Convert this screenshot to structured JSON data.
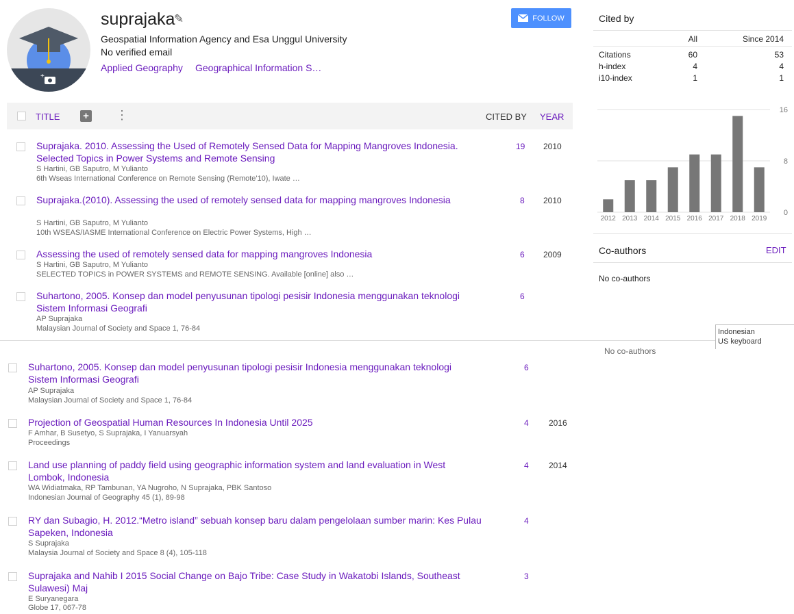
{
  "profile": {
    "name": "suprajaka",
    "affiliation": "Geospatial Information Agency and Esa Unggul University",
    "email": "No verified email",
    "interests": [
      "Applied Geography",
      "Geographical Information S…"
    ],
    "follow_label": "FOLLOW"
  },
  "table_header": {
    "title": "TITLE",
    "cited_by": "CITED BY",
    "year": "YEAR"
  },
  "articles_top": [
    {
      "title": "Suprajaka. 2010. Assessing the Used of Remotely Sensed Data for Mapping Mangroves Indonesia. Selected Topics in Power Systems and Remote Sensing",
      "authors": "S Hartini, GB Saputro, M Yulianto",
      "pub": "6th Wseas International Conference on Remote Sensing (Remote'10), Iwate …",
      "cited": "19",
      "year": "2010"
    },
    {
      "title": "Suprajaka.(2010). Assessing the used of remotely sensed data for mapping mangroves Indonesia",
      "authors": "S Hartini, GB Saputro, M Yulianto",
      "pub": "10th WSEAS/IASME International Conference on Electric Power Systems, High …",
      "cited": "8",
      "year": "2010"
    },
    {
      "title": "Assessing the used of remotely sensed data for mapping mangroves Indonesia",
      "authors": "S Hartini, GB Saputro, M Yulianto",
      "pub": "SELECTED TOPICS in POWER SYSTEMS and REMOTE SENSING. Available [online] also …",
      "cited": "6",
      "year": "2009"
    },
    {
      "title": "Suhartono, 2005. Konsep dan model penyusunan tipologi pesisir Indonesia menggunakan teknologi Sistem Informasi Geografi",
      "authors": "AP Suprajaka",
      "pub": "Malaysian Journal of Society and Space 1, 76-84",
      "cited": "6",
      "year": ""
    }
  ],
  "articles_bottom": [
    {
      "title": "Suhartono, 2005. Konsep dan model penyusunan tipologi pesisir Indonesia menggunakan teknologi Sistem Informasi Geografi",
      "authors": "AP Suprajaka",
      "pub": "Malaysian Journal of Society and Space 1, 76-84",
      "cited": "6",
      "year": ""
    },
    {
      "title": "Projection of Geospatial Human Resources In Indonesia Until 2025",
      "authors": "F Amhar, B Susetyo, S Suprajaka, I Yanuarsyah",
      "pub": "Proceedings",
      "cited": "4",
      "year": "2016"
    },
    {
      "title": "Land use planning of paddy field using geographic information system and land evaluation in West Lombok, Indonesia",
      "authors": "WA Widiatmaka, RP Tambunan, YA Nugroho, N Suprajaka, PBK Santoso",
      "pub": "Indonesian Journal of Geography 45 (1), 89-98",
      "cited": "4",
      "year": "2014"
    },
    {
      "title": "RY dan Subagio, H. 2012.“Metro island” sebuah konsep baru dalam pengelolaan sumber marin: Kes Pulau Sapeken, Indonesia",
      "authors": "S Suprajaka",
      "pub": "Malaysia Journal of Society and Space 8 (4), 105-118",
      "cited": "4",
      "year": ""
    },
    {
      "title": "Suprajaka and Nahib I 2015 Social Change on Bajo Tribe: Case Study in Wakatobi Islands, Southeast Sulawesi) Maj",
      "authors": "E Suryanegara",
      "pub": "Globe 17, 067-78",
      "cited": "3",
      "year": ""
    }
  ],
  "cited_by": {
    "heading": "Cited by",
    "col_all": "All",
    "col_since": "Since 2014",
    "rows": [
      {
        "label": "Citations",
        "all": "60",
        "since": "53"
      },
      {
        "label": "h-index",
        "all": "4",
        "since": "4"
      },
      {
        "label": "i10-index",
        "all": "1",
        "since": "1"
      }
    ]
  },
  "chart_data": {
    "type": "bar",
    "categories": [
      "2012",
      "2013",
      "2014",
      "2015",
      "2016",
      "2017",
      "2018",
      "2019"
    ],
    "values": [
      2,
      5,
      5,
      7,
      9,
      9,
      15,
      7
    ],
    "y_ticks": [
      "0",
      "8",
      "16"
    ],
    "ylim": [
      0,
      16
    ],
    "bar_color": "#777777"
  },
  "coauthors": {
    "heading": "Co-authors",
    "edit_label": "EDIT",
    "empty": "No co-authors",
    "ghost": "No co-authors"
  },
  "keyboard": {
    "language": "Indonesian",
    "layout": "US keyboard"
  },
  "colors": {
    "link": "#6a1bbd",
    "follow": "#4d90fe"
  }
}
